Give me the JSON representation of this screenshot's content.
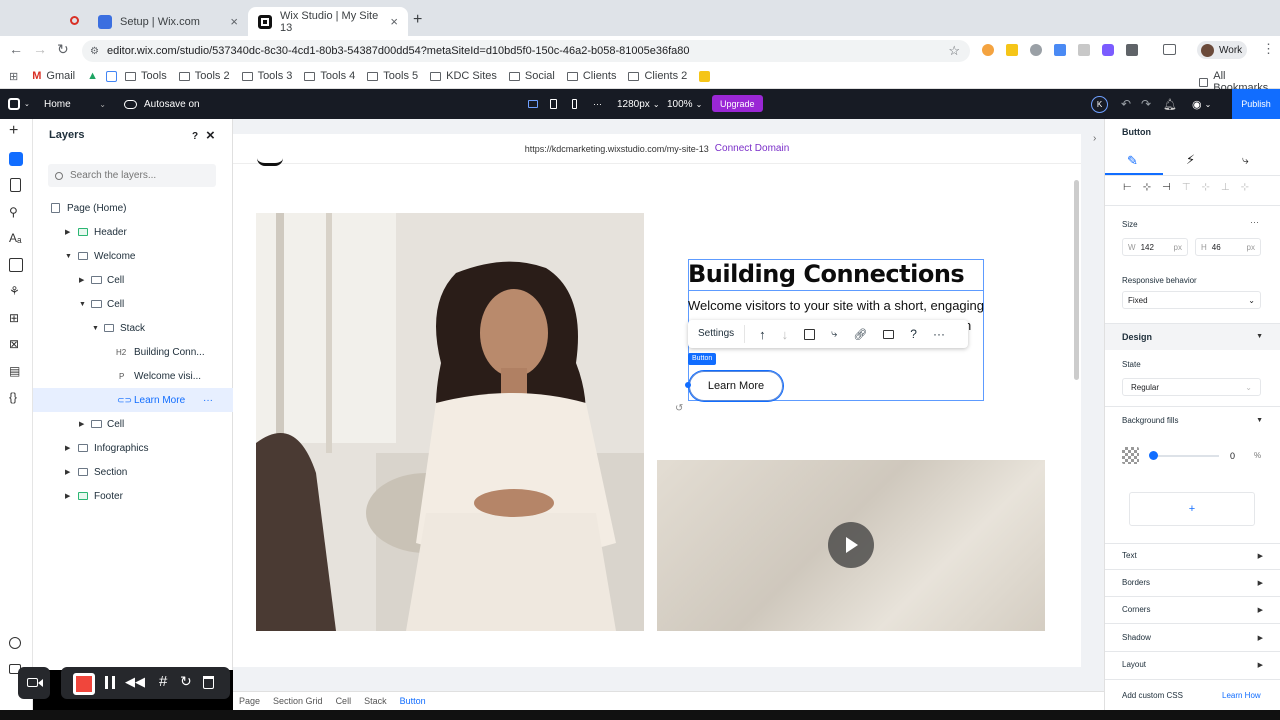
{
  "browser": {
    "tabs": [
      {
        "title": "Setup | Wix.com"
      },
      {
        "title": "Wix Studio | My Site 13"
      }
    ],
    "url": "editor.wix.com/studio/537340dc-8c30-4cd1-80b3-54387d00dd54?metaSiteId=d10bd5f0-150c-46a2-b058-81005e36fa80",
    "profile": "Work",
    "profile_initial": "K",
    "bookmarks": [
      "Gmail",
      "Tools",
      "Tools 2",
      "Tools 3",
      "Tools 4",
      "Tools 5",
      "KDC Sites",
      "Social",
      "Clients",
      "Clients 2"
    ],
    "all_bookmarks": "All Bookmarks"
  },
  "wix": {
    "page": "Home",
    "autosave": "Autosave on",
    "breakpoint": "1280px",
    "zoom": "100%",
    "upgrade": "Upgrade",
    "publish": "Publish",
    "user_initial": "K"
  },
  "layers": {
    "title": "Layers",
    "help": "?",
    "search_placeholder": "Search the layers...",
    "items": [
      {
        "label": "Page (Home)"
      },
      {
        "label": "Header"
      },
      {
        "label": "Welcome"
      },
      {
        "label": "Cell"
      },
      {
        "label": "Cell"
      },
      {
        "label": "Stack"
      },
      {
        "label": "Building Conn...",
        "type": "H2"
      },
      {
        "label": "Welcome visi...",
        "type": "P"
      },
      {
        "label": "Learn More"
      },
      {
        "label": "Cell"
      },
      {
        "label": "Infographics"
      },
      {
        "label": "Section"
      },
      {
        "label": "Footer"
      }
    ]
  },
  "canvas": {
    "site_url": "https://kdcmarketing.wixstudio.com/my-site-13",
    "connect_domain": "Connect Domain",
    "heading": "Building Connections",
    "paragraph": "Welcome visitors to your site with a short, engaging",
    "paragraph_tail": "n",
    "button_label": "Learn More",
    "selection_tag": "Button",
    "float_toolbar_settings": "Settings"
  },
  "inspector": {
    "title": "Button",
    "size_label": "Size",
    "width_label": "W",
    "width": "142",
    "height_label": "H",
    "height": "46",
    "unit": "px",
    "responsive_label": "Responsive behavior",
    "responsive_value": "Fixed",
    "design": "Design",
    "state_label": "State",
    "state_value": "Regular",
    "bg_fills": "Background fills",
    "opacity": "0",
    "opacity_unit": "%",
    "sections": [
      "Text",
      "Borders",
      "Corners",
      "Shadow",
      "Layout"
    ],
    "custom_css": "Add custom CSS",
    "learn_how": "Learn How"
  },
  "breadcrumbs": [
    "Page",
    "Section Grid",
    "Cell",
    "Stack",
    "Button"
  ],
  "colors": {
    "accent": "#116dff",
    "wix_dark": "#171b24",
    "upgrade": "#9a27d5"
  }
}
